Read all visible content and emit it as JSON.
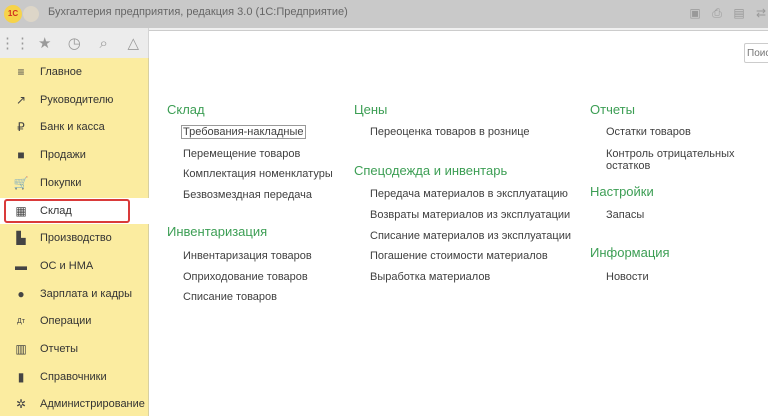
{
  "window": {
    "title": "Бухгалтерия предприятия, редакция 3.0  (1С:Предприятие)",
    "logo": "1С"
  },
  "toolbar_icons": [
    "apps-grid-icon",
    "star-icon",
    "history-icon",
    "search-icon",
    "bell-icon"
  ],
  "search": {
    "placeholder": "Поиск"
  },
  "sidebar": {
    "items": [
      {
        "label": "Главное",
        "icon": "menu-lines-icon"
      },
      {
        "label": "Руководителю",
        "icon": "trend-icon"
      },
      {
        "label": "Банк и касса",
        "icon": "ruble-coin-icon"
      },
      {
        "label": "Продажи",
        "icon": "shopping-bag-icon"
      },
      {
        "label": "Покупки",
        "icon": "cart-icon"
      },
      {
        "label": "Склад",
        "icon": "warehouse-grid-icon",
        "selected": true
      },
      {
        "label": "Производство",
        "icon": "factory-icon"
      },
      {
        "label": "ОС и НМА",
        "icon": "truck-icon"
      },
      {
        "label": "Зарплата и кадры",
        "icon": "person-icon"
      },
      {
        "label": "Операции",
        "icon": "debit-credit-icon"
      },
      {
        "label": "Отчеты",
        "icon": "bar-chart-icon"
      },
      {
        "label": "Справочники",
        "icon": "books-icon"
      },
      {
        "label": "Администрирование",
        "icon": "gear-icon"
      }
    ]
  },
  "sections": [
    {
      "title": "Склад",
      "items": [
        "Требования-накладные",
        "Перемещение товаров",
        "Комплектация номенклатуры",
        "Безвозмездная передача"
      ]
    },
    {
      "title": "Инвентаризация",
      "items": [
        "Инвентаризация товаров",
        "Оприходование товаров",
        "Списание товаров"
      ]
    },
    {
      "title": "Цены",
      "items": [
        "Переоценка товаров в рознице"
      ]
    },
    {
      "title": "Спецодежда и инвентарь",
      "items": [
        "Передача материалов в эксплуатацию",
        "Возвраты материалов из эксплуатации",
        "Списание материалов из эксплуатации",
        "Погашение стоимости материалов",
        "Выработка материалов"
      ]
    },
    {
      "title": "Отчеты",
      "items": [
        "Остатки товаров",
        "Контроль отрицательных остатков"
      ]
    },
    {
      "title": "Настройки",
      "items": [
        "Запасы"
      ]
    },
    {
      "title": "Информация",
      "items": [
        "Новости"
      ]
    }
  ],
  "colors": {
    "accent": "#3c9e54",
    "sidebar": "#fbeca0",
    "highlight": "#d93a3a"
  }
}
